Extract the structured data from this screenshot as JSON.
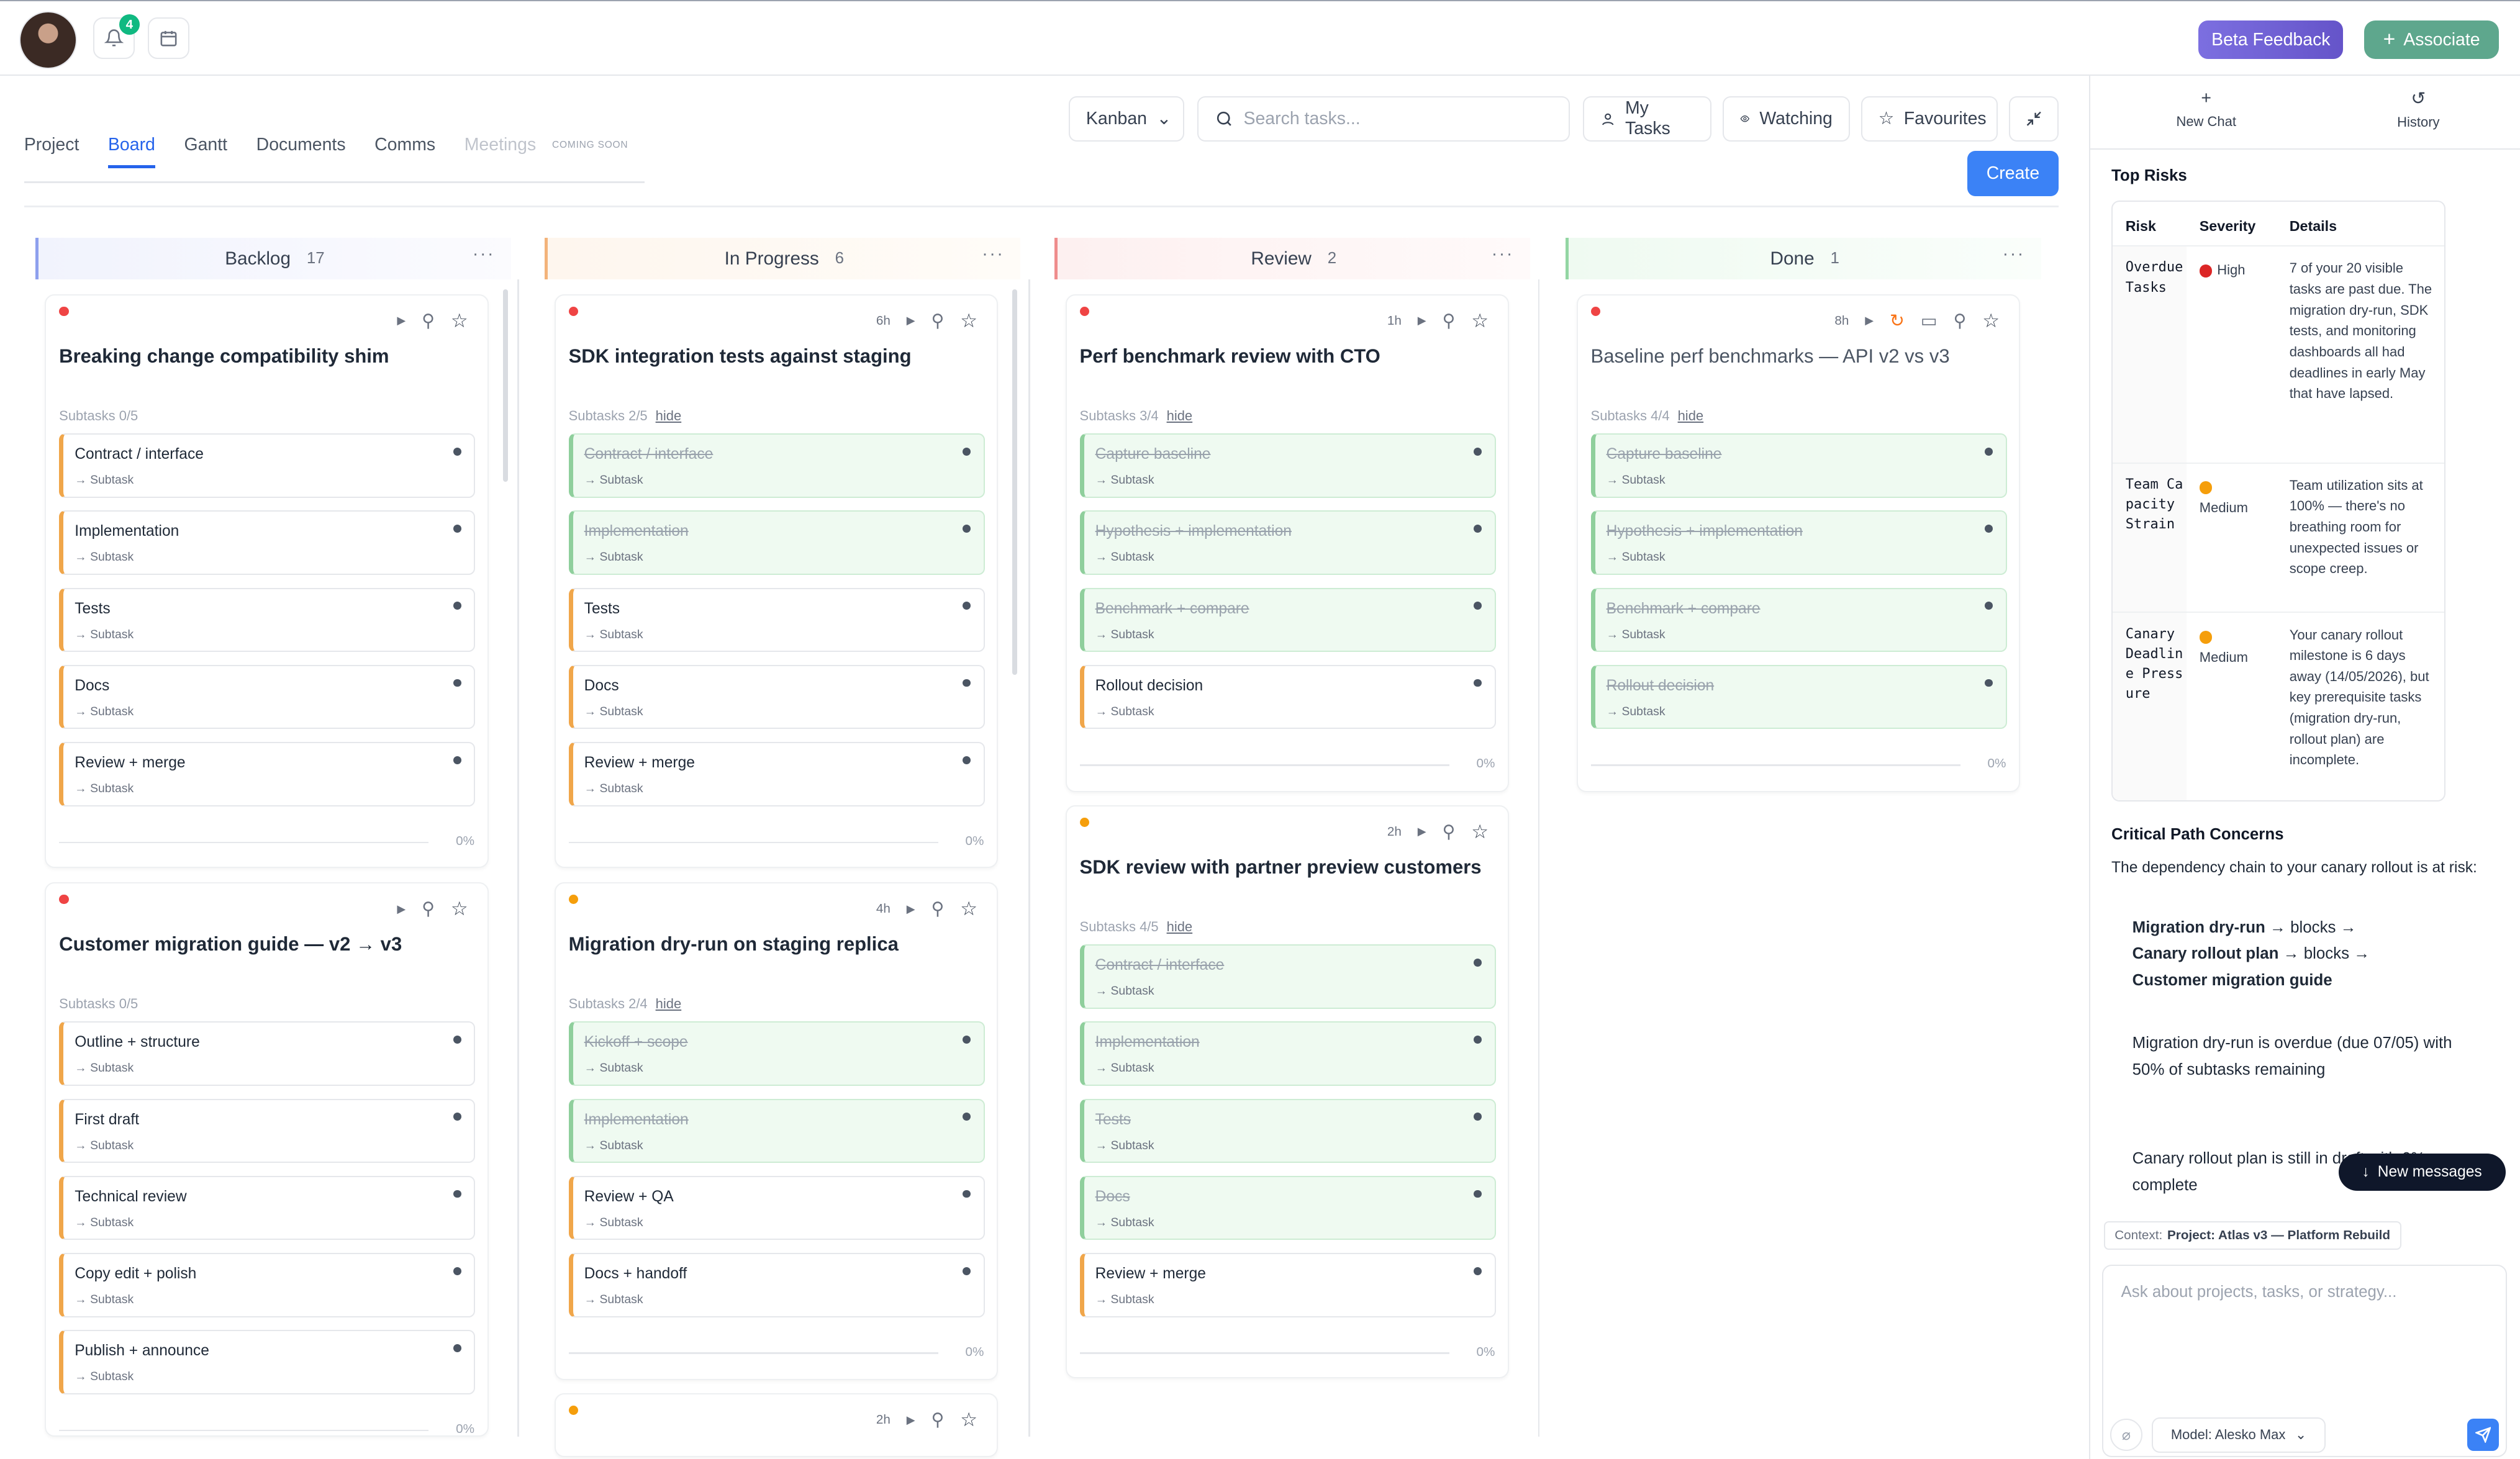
{
  "topbar": {
    "notif_count": "4",
    "beta": "Beta Feedback",
    "associate": "Associate"
  },
  "tabs": [
    {
      "label": "Project"
    },
    {
      "label": "Board"
    },
    {
      "label": "Gantt"
    },
    {
      "label": "Documents"
    },
    {
      "label": "Comms"
    },
    {
      "label": "Meetings"
    }
  ],
  "coming_soon": "COMING SOON",
  "toolbar": {
    "view": "Kanban",
    "search_placeholder": "Search tasks...",
    "my_tasks": "My Tasks",
    "watching": "Watching",
    "favourites": "Favourites",
    "create": "Create"
  },
  "columns": [
    {
      "name": "Backlog",
      "count": "17",
      "color": "#8ea0ee"
    },
    {
      "name": "In Progress",
      "count": "6",
      "color": "#f3b37a"
    },
    {
      "name": "Review",
      "count": "2",
      "color": "#ef8d8d"
    },
    {
      "name": "Done",
      "count": "1",
      "color": "#93d6a3"
    }
  ],
  "cards": [
    {
      "title": "Breaking change compatibility shim",
      "dot": "#ef4444",
      "time": "",
      "subtasks_label": "Subtasks 0/5",
      "hide": "",
      "subtasks": [
        {
          "name": "Contract / interface",
          "done": false
        },
        {
          "name": "Implementation",
          "done": false
        },
        {
          "name": "Tests",
          "done": false
        },
        {
          "name": "Docs",
          "done": false
        },
        {
          "name": "Review + merge",
          "done": false
        }
      ],
      "progress": "0%",
      "progress_value": 0
    },
    {
      "title": "Customer migration guide — v2 → v3",
      "dot": "#ef4444",
      "time": "",
      "subtasks_label": "Subtasks 0/5",
      "hide": "",
      "subtasks": [
        {
          "name": "Outline + structure",
          "done": false
        },
        {
          "name": "First draft",
          "done": false
        },
        {
          "name": "Technical review",
          "done": false
        },
        {
          "name": "Copy edit + polish",
          "done": false
        },
        {
          "name": "Publish + announce",
          "done": false
        }
      ],
      "progress": "0%",
      "progress_value": 0
    },
    {
      "title": "SDK integration tests against staging",
      "dot": "#ef4444",
      "time": "6h",
      "subtasks_label": "Subtasks 2/5",
      "hide": "hide",
      "subtasks": [
        {
          "name": "Contract / interface",
          "done": true
        },
        {
          "name": "Implementation",
          "done": true
        },
        {
          "name": "Tests",
          "done": false
        },
        {
          "name": "Docs",
          "done": false
        },
        {
          "name": "Review + merge",
          "done": false
        }
      ],
      "progress": "0%",
      "progress_value": 0
    },
    {
      "title": "Migration dry-run on staging replica",
      "dot": "#f59e0b",
      "time": "4h",
      "subtasks_label": "Subtasks 2/4",
      "hide": "hide",
      "subtasks": [
        {
          "name": "Kickoff + scope",
          "done": true
        },
        {
          "name": "Implementation",
          "done": true
        },
        {
          "name": "Review + QA",
          "done": false
        },
        {
          "name": "Docs + handoff",
          "done": false
        }
      ],
      "progress": "0%",
      "progress_value": 0
    },
    {
      "title": "",
      "dot": "#f59e0b",
      "time": "2h",
      "subtasks_label": "",
      "hide": "",
      "subtasks": [],
      "progress": "",
      "progress_value": 0
    },
    {
      "title": "Perf benchmark review with CTO",
      "dot": "#ef4444",
      "time": "1h",
      "subtasks_label": "Subtasks 3/4",
      "hide": "hide",
      "subtasks": [
        {
          "name": "Capture baseline",
          "done": true
        },
        {
          "name": "Hypothesis + implementation",
          "done": true
        },
        {
          "name": "Benchmark + compare",
          "done": true
        },
        {
          "name": "Rollout decision",
          "done": false
        }
      ],
      "progress": "0%",
      "progress_value": 0
    },
    {
      "title": "SDK review with partner preview customers",
      "dot": "#f59e0b",
      "time": "2h",
      "subtasks_label": "Subtasks 4/5",
      "hide": "hide",
      "subtasks": [
        {
          "name": "Contract / interface",
          "done": true
        },
        {
          "name": "Implementation",
          "done": true
        },
        {
          "name": "Tests",
          "done": true
        },
        {
          "name": "Docs",
          "done": true
        },
        {
          "name": "Review + merge",
          "done": false
        }
      ],
      "progress": "0%",
      "progress_value": 0
    },
    {
      "title": "Baseline perf benchmarks — API v2 vs v3",
      "dot": "#ef4444",
      "time": "8h",
      "subtasks_label": "Subtasks 4/4",
      "hide": "hide",
      "subtasks": [
        {
          "name": "Capture baseline",
          "done": true
        },
        {
          "name": "Hypothesis + implementation",
          "done": true
        },
        {
          "name": "Benchmark + compare",
          "done": true
        },
        {
          "name": "Rollout decision",
          "done": true
        }
      ],
      "progress": "0%",
      "progress_value": 0
    }
  ],
  "subtask_label": "Subtask",
  "panel": {
    "new_chat": "New Chat",
    "history": "History",
    "top_risks": "Top Risks",
    "headers": {
      "risk": "Risk",
      "severity": "Severity",
      "details": "Details"
    },
    "risks": [
      {
        "risk": "Overdue Tasks",
        "severity": "High",
        "color": "#dc2626",
        "details": "7 of your 20 visible tasks are past due. The migration dry-run, SDK tests, and monitoring dashboards all had deadlines in early May that have lapsed."
      },
      {
        "risk": "Team Capacity Strain",
        "severity": "Medium",
        "color": "#f59e0b",
        "details": "Team utilization sits at 100% — there's no breathing room for unexpected issues or scope creep."
      },
      {
        "risk": "Canary Deadline Pressure",
        "severity": "Medium",
        "color": "#f59e0b",
        "details": "Your canary rollout milestone is 6 days away (14/05/2026), but key prerequisite tasks (migration dry-run, rollout plan) are incomplete."
      }
    ],
    "critical_title": "Critical Path Concerns",
    "critical_intro": "The dependency chain to your canary rollout is at risk:",
    "chain": {
      "a": "Migration dry-run",
      "b": "Canary rollout plan",
      "c": "Customer migration guide",
      "arrow1": " → blocks →",
      "arrow2": " → blocks →"
    },
    "para1": "Migration dry-run is overdue (due 07/05) with 50% of subtasks remaining",
    "para2": "Canary rollout plan is still in draft with 0% complete",
    "new_messages": "New messages",
    "context_label": "Context:",
    "context_value": "Project: Atlas v3 — Platform Rebuild",
    "input_placeholder": "Ask about projects, tasks, or strategy...",
    "model": "Model: Alesko Max"
  }
}
